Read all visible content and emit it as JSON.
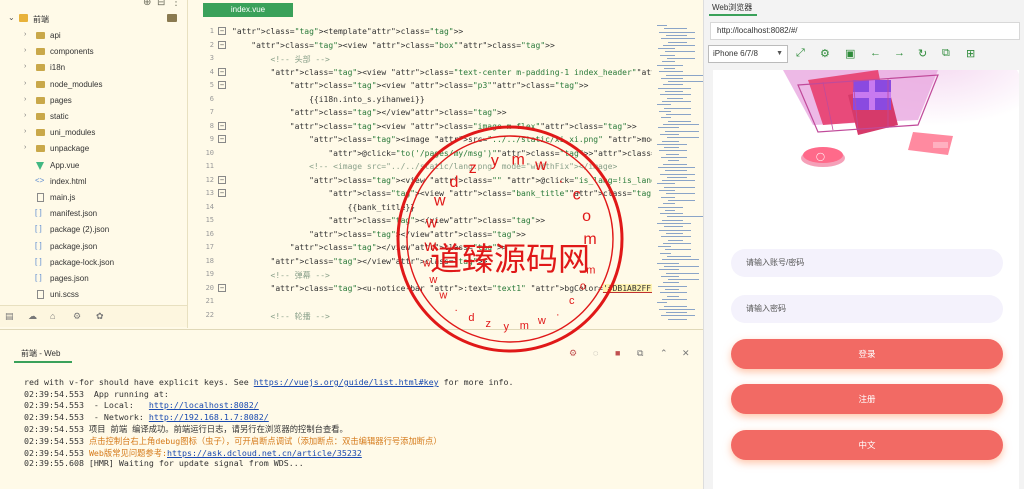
{
  "sidebar": {
    "root_label": "前端",
    "items": [
      {
        "label": "api",
        "kind": "folder"
      },
      {
        "label": "components",
        "kind": "folder"
      },
      {
        "label": "i18n",
        "kind": "folder"
      },
      {
        "label": "node_modules",
        "kind": "folder"
      },
      {
        "label": "pages",
        "kind": "folder"
      },
      {
        "label": "static",
        "kind": "folder"
      },
      {
        "label": "uni_modules",
        "kind": "folder"
      },
      {
        "label": "unpackage",
        "kind": "folder"
      },
      {
        "label": "App.vue",
        "kind": "vue"
      },
      {
        "label": "index.html",
        "kind": "code"
      },
      {
        "label": "main.js",
        "kind": "file"
      },
      {
        "label": "manifest.json",
        "kind": "code"
      },
      {
        "label": "package (2).json",
        "kind": "code"
      },
      {
        "label": "package.json",
        "kind": "code"
      },
      {
        "label": "package-lock.json",
        "kind": "code"
      },
      {
        "label": "pages.json",
        "kind": "code"
      },
      {
        "label": "uni.scss",
        "kind": "file"
      }
    ]
  },
  "editor": {
    "tab_label": "index.vue",
    "lines": [
      {
        "n": "1",
        "text": "<template>"
      },
      {
        "n": "2",
        "text": "    <view class=\"box\">"
      },
      {
        "n": "3",
        "text": "        <!-- 头部 -->"
      },
      {
        "n": "4",
        "text": "        <view class=\"text-center m-padding-1 index_header\">"
      },
      {
        "n": "5",
        "text": "            <view class=\"p3\">"
      },
      {
        "n": "6",
        "text": "                {{i18n.into_s.yihanwei}}"
      },
      {
        "n": "7",
        "text": "            </view>"
      },
      {
        "n": "8",
        "text": "            <view class=\"image m-flex\">"
      },
      {
        "n": "9",
        "text": "                <image src=\"../../static/xi.xi.png\" mode=\"widthFix\" class=\"m-mar"
      },
      {
        "n": "10",
        "text": "                    @click=\"to('/pages/my/msg')\"></image>"
      },
      {
        "n": "11",
        "text": "                <!-- <image src=\"../../static/lang.png\" mode=\"widthFix\"></image>"
      },
      {
        "n": "12",
        "text": "                <view class=\"\" @click=\"is_lang=!is_lang \">"
      },
      {
        "n": "13",
        "text": "                    <view class=\"bank_title\">"
      },
      {
        "n": "14",
        "text": "                        {{bank_title}}"
      },
      {
        "n": "15",
        "text": "                    </view>"
      },
      {
        "n": "16",
        "text": "                </view>"
      },
      {
        "n": "17",
        "text": "            </view>"
      },
      {
        "n": "18",
        "text": "        </view>"
      },
      {
        "n": "19",
        "text": "        <!-- 弹幕 -->"
      },
      {
        "n": "20",
        "text": "        <u-notice-bar :text=\"text1\" bgColor='#DB1AB2FF' icon='' color='#fff'></u-"
      },
      {
        "n": "21",
        "text": ""
      },
      {
        "n": "22",
        "text": "        <!-- 轮播 -->"
      }
    ]
  },
  "console": {
    "tab_label": "前端 - Web",
    "lines": [
      {
        "pre": "red with v-for should have explicit keys. See ",
        "link": "https://vuejs.org/guide/list.html#key",
        "post": " for more info."
      },
      {
        "pre": "02:39:54.553  App running at:",
        "link": "",
        "post": ""
      },
      {
        "pre": "02:39:54.553  - Local:   ",
        "link": "http://localhost:8082/",
        "post": ""
      },
      {
        "pre": "02:39:54.553  - Network: ",
        "link": "http://192.168.1.7:8082/",
        "post": ""
      },
      {
        "pre": "02:39:54.553 项目 前端 编译成功。前端运行日志，请另行在浏览器的控制台查看。",
        "link": "",
        "post": ""
      },
      {
        "pre": "02:39:54.553 ",
        "warn": "点击控制台右上角debug图标（虫子），可开启断点调试（添加断点：双击编辑器行号添加断点）",
        "link": "",
        "post": ""
      },
      {
        "pre": "02:39:54.553 ",
        "warn": "Web版常见问题参考:",
        "link": "https://ask.dcloud.net.cn/article/35232",
        "post": ""
      },
      {
        "pre": "02:39:55.608 [HMR] Waiting for update signal from WDS...",
        "link": "",
        "post": ""
      }
    ]
  },
  "browser": {
    "title": "Web浏览器",
    "url": "http://localhost:8082/#/",
    "device": "iPhone 6/7/8",
    "phone": {
      "account_placeholder": "请输入账号/密码",
      "password_placeholder": "请输入密码",
      "login_label": "登录",
      "register_label": "注册",
      "language_label": "中文"
    }
  },
  "watermark": {
    "center_text": "道臻源码网",
    "ring_top": [
      "w",
      "w",
      "w",
      "d",
      "z",
      "y",
      "m",
      "w",
      ".",
      "c",
      "o",
      "m"
    ],
    "ring_bottom": [
      "w",
      "w",
      "w",
      ".",
      "d",
      "z",
      "y",
      "m",
      "w",
      ".",
      "c",
      "o",
      "m"
    ]
  },
  "colors": {
    "accent_green": "#3aa15a",
    "button_coral": "#f26a64",
    "watermark_red": "#e01818"
  }
}
